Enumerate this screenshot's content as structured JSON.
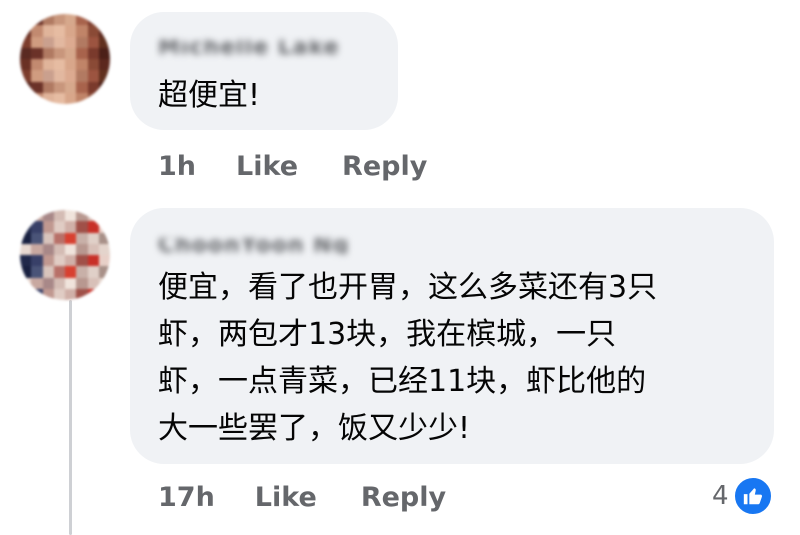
{
  "comments": [
    {
      "author": "Michelle Lake",
      "text": "超便宜!",
      "time": "1h",
      "like_label": "Like",
      "reply_label": "Reply"
    },
    {
      "author": "ChoonYoon Ng",
      "text": "便宜，看了也开胃，这么多菜还有3只\n虾，两包才13块，我在槟城，一只\n虾，一点青菜，已经11块，虾比他的\n大一些罢了，饭又少少!",
      "time": "17h",
      "like_label": "Like",
      "reply_label": "Reply",
      "reaction_count": "4",
      "reaction_icon": "like-icon"
    }
  ],
  "colors": {
    "bubble_bg": "#f0f2f5",
    "secondary_text": "#65676b",
    "primary_text": "#050505",
    "like_blue": "#1877f2",
    "thread_line": "#ced0d4"
  }
}
